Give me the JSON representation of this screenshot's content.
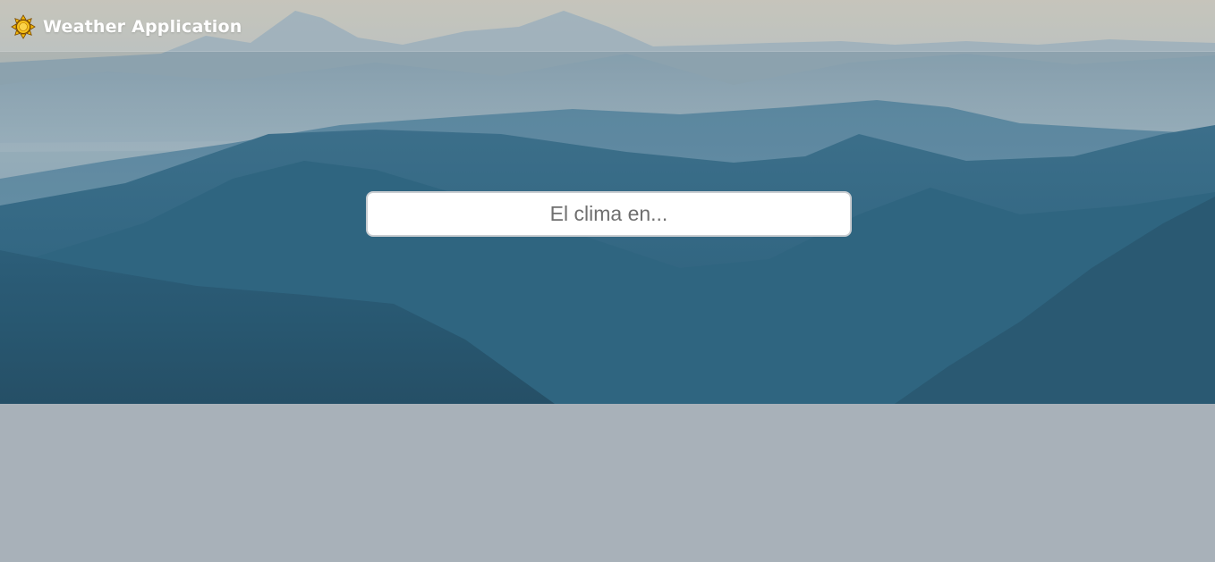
{
  "app": {
    "title": "Weather Application",
    "logo_icon": "sun-icon",
    "logo_color": "#f2b705"
  },
  "search": {
    "placeholder": "El clima en...",
    "value": ""
  },
  "colors": {
    "page_background": "#a8b1b9",
    "mountain_dark": "#2f5f78",
    "sky": "#c7c3b6"
  }
}
